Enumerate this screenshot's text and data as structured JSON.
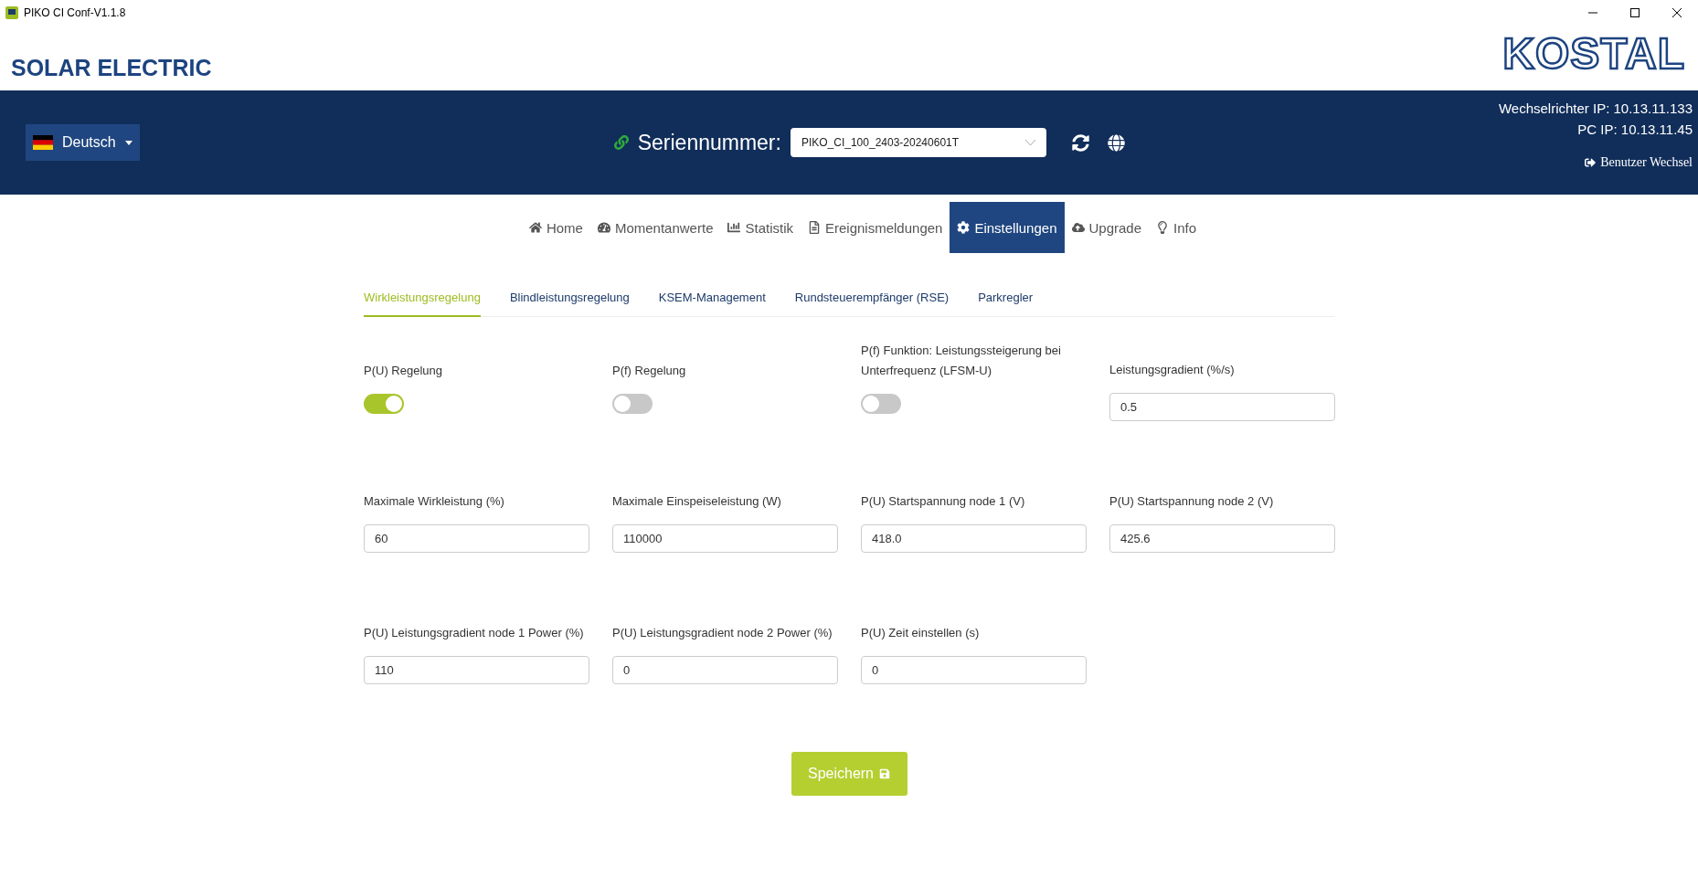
{
  "window": {
    "title": "PIKO CI Conf-V1.1.8"
  },
  "header": {
    "brand": "SOLAR ELECTRIC",
    "logo": "KOSTAL"
  },
  "topbar": {
    "language": "Deutsch",
    "serial_label": "Seriennummer:",
    "serial_value": "PIKO_CI_100_2403-20240601T",
    "inverter_ip": "Wechselrichter IP: 10.13.11.133",
    "pc_ip": "PC IP: 10.13.11.45",
    "user_switch": "Benutzer Wechsel"
  },
  "nav": [
    {
      "label": "Home",
      "selected": false
    },
    {
      "label": "Momentanwerte",
      "selected": false
    },
    {
      "label": "Statistik",
      "selected": false
    },
    {
      "label": "Ereignismeldungen",
      "selected": false
    },
    {
      "label": "Einstellungen",
      "selected": true
    },
    {
      "label": "Upgrade",
      "selected": false
    },
    {
      "label": "Info",
      "selected": false
    }
  ],
  "subtabs": [
    {
      "label": "Wirkleistungsregelung",
      "selected": true
    },
    {
      "label": "Blindleistungsregelung",
      "selected": false
    },
    {
      "label": "KSEM-Management",
      "selected": false
    },
    {
      "label": "Rundsteuerempfänger (RSE)",
      "selected": false
    },
    {
      "label": "Parkregler",
      "selected": false
    }
  ],
  "fields": [
    {
      "kind": "toggle",
      "label": "P(U) Regelung",
      "on": true
    },
    {
      "kind": "toggle",
      "label": "P(f) Regelung",
      "on": false
    },
    {
      "kind": "toggle",
      "label": "P(f) Funktion: Leistungssteigerung bei Unterfrequenz (LFSM-U)",
      "on": false
    },
    {
      "kind": "input",
      "label": "Leistungsgradient (%/s)",
      "value": "0.5"
    },
    {
      "kind": "input",
      "label": "Maximale Wirkleistung (%)",
      "value": "60"
    },
    {
      "kind": "input",
      "label": "Maximale Einspeiseleistung (W)",
      "value": "110000"
    },
    {
      "kind": "input",
      "label": "P(U) Startspannung node 1 (V)",
      "value": "418.0"
    },
    {
      "kind": "input",
      "label": "P(U) Startspannung node 2 (V)",
      "value": "425.6"
    },
    {
      "kind": "input",
      "label": "P(U) Leistungsgradient node 1 Power (%)",
      "value": "110"
    },
    {
      "kind": "input",
      "label": "P(U) Leistungsgradient node 2 Power (%)",
      "value": "0"
    },
    {
      "kind": "input",
      "label": "P(U) Zeit einstellen (s)",
      "value": "0"
    }
  ],
  "save_button": "Speichern"
}
